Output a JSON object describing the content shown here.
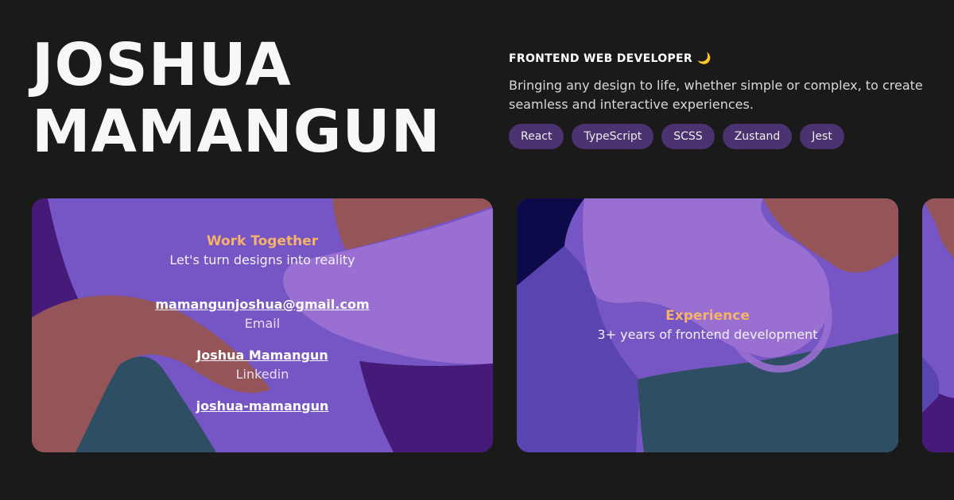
{
  "hero": {
    "first_name": "JOSHUA",
    "last_name": "MAMANGUN"
  },
  "intro": {
    "role": "FRONTEND WEB DEVELOPER",
    "role_emoji": "🌙",
    "tagline": "Bringing any design to life, whether simple or complex, to create seamless and interactive experiences.",
    "tags": [
      "React",
      "TypeScript",
      "SCSS",
      "Zustand",
      "Jest"
    ]
  },
  "cards": {
    "contact": {
      "title": "Work Together",
      "subtitle": "Let's turn designs into reality",
      "email_value": "mamangunjoshua@gmail.com",
      "email_label": "Email",
      "linkedin_value": "Joshua Mamangun",
      "linkedin_label": "Linkedin",
      "github_value": "joshua-mamangun"
    },
    "experience": {
      "title": "Experience",
      "subtitle": "3+ years of frontend development"
    }
  },
  "colors": {
    "background": "#1a1a1a",
    "accent": "#f6b26b",
    "tag_bg": "#4b3270",
    "card_purple": "#7655c4",
    "card_lavender": "#9a6fd2",
    "card_rose": "#955558",
    "card_teal": "#2e4f63",
    "card_deep": "#461a78"
  }
}
